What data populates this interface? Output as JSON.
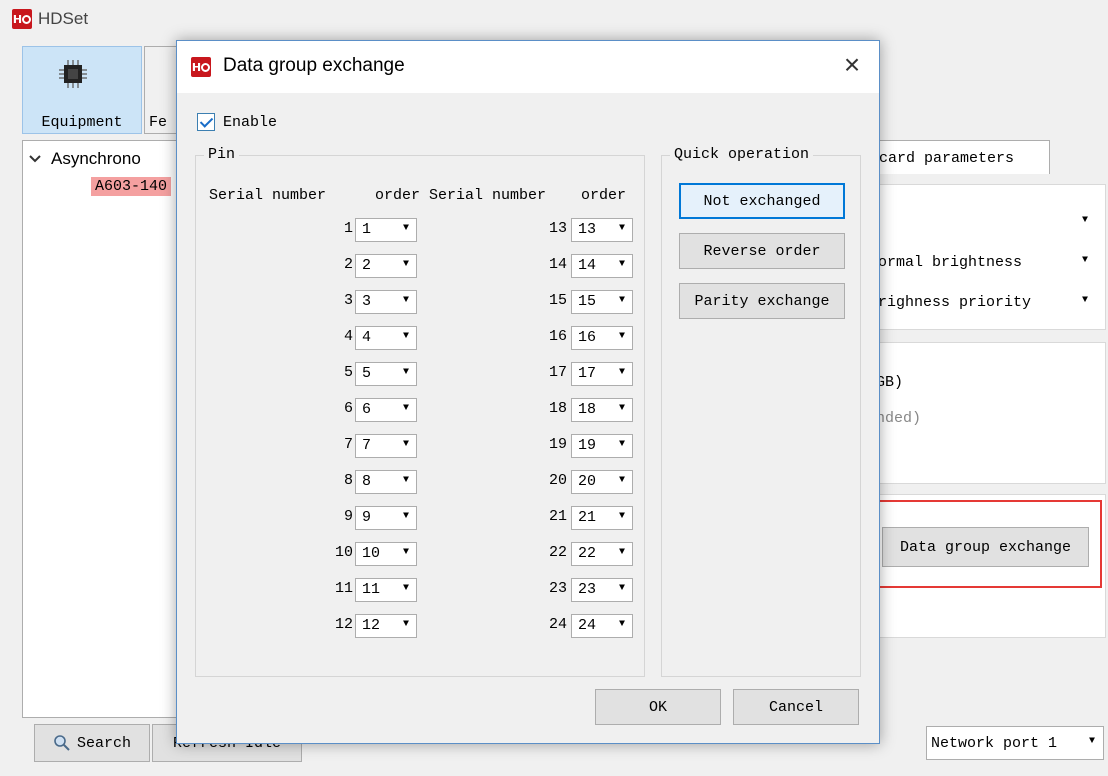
{
  "app": {
    "title": "HDSet",
    "logo_text": "H"
  },
  "toolbar": {
    "equipment_label": "Equipment",
    "second_label": "Fe"
  },
  "tree": {
    "root_label": "Asynchrono",
    "child_label": "A603-140"
  },
  "background": {
    "tab_label": "card parameters",
    "select_1": "",
    "select_2": "ormal brightness",
    "select_3": "righness priority",
    "text_1": "GB)",
    "text_2": "nded)",
    "data_group_button": "Data group exchange",
    "search_label": "Search",
    "refresh_label": "Refresh  Idle",
    "network_port": "Network port 1"
  },
  "dialog": {
    "title": "Data group exchange",
    "enable_label": "Enable",
    "enabled": true,
    "pin_group_title": "Pin",
    "col_serial": "Serial number",
    "col_order": "order",
    "quick_title": "Quick operation",
    "btn_not_exchanged": "Not exchanged",
    "btn_reverse": "Reverse order",
    "btn_parity": "Parity exchange",
    "ok_label": "OK",
    "cancel_label": "Cancel",
    "pins": [
      {
        "serial": "1",
        "order": "1"
      },
      {
        "serial": "2",
        "order": "2"
      },
      {
        "serial": "3",
        "order": "3"
      },
      {
        "serial": "4",
        "order": "4"
      },
      {
        "serial": "5",
        "order": "5"
      },
      {
        "serial": "6",
        "order": "6"
      },
      {
        "serial": "7",
        "order": "7"
      },
      {
        "serial": "8",
        "order": "8"
      },
      {
        "serial": "9",
        "order": "9"
      },
      {
        "serial": "10",
        "order": "10"
      },
      {
        "serial": "11",
        "order": "11"
      },
      {
        "serial": "12",
        "order": "12"
      },
      {
        "serial": "13",
        "order": "13"
      },
      {
        "serial": "14",
        "order": "14"
      },
      {
        "serial": "15",
        "order": "15"
      },
      {
        "serial": "16",
        "order": "16"
      },
      {
        "serial": "17",
        "order": "17"
      },
      {
        "serial": "18",
        "order": "18"
      },
      {
        "serial": "19",
        "order": "19"
      },
      {
        "serial": "20",
        "order": "20"
      },
      {
        "serial": "21",
        "order": "21"
      },
      {
        "serial": "22",
        "order": "22"
      },
      {
        "serial": "23",
        "order": "23"
      },
      {
        "serial": "24",
        "order": "24"
      }
    ]
  },
  "colors": {
    "accent": "#0078d7",
    "highlight_frame": "#e53935",
    "logo": "#c8171d",
    "tree_selection": "#f4a0a0"
  }
}
